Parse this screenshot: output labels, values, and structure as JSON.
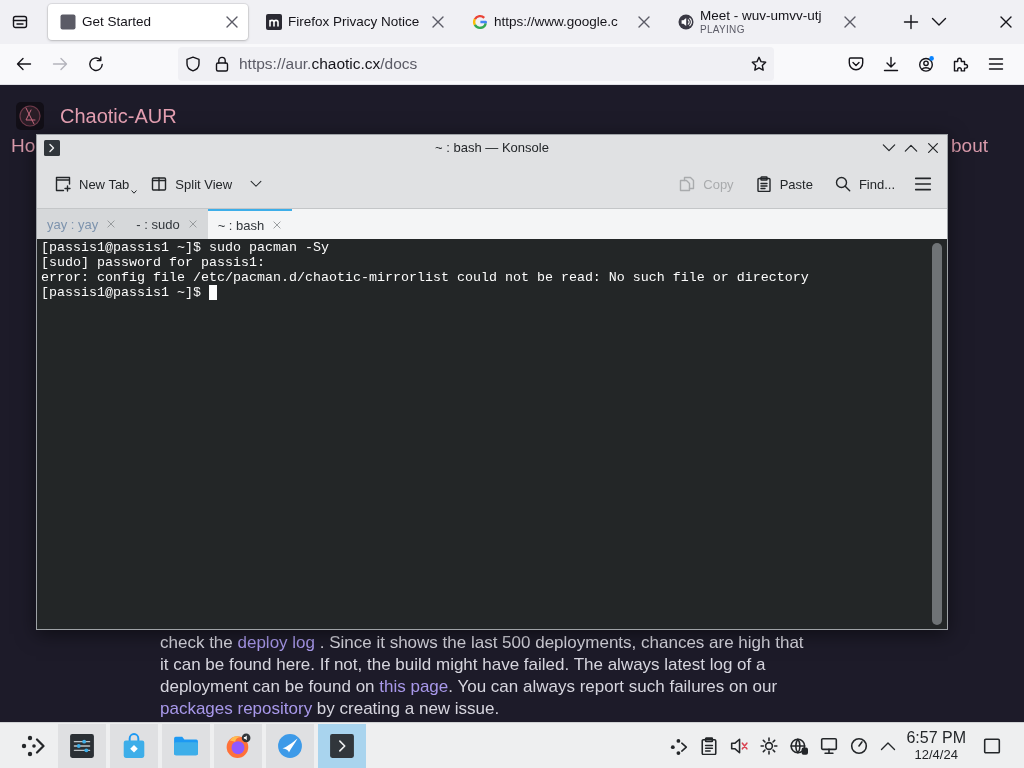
{
  "browser": {
    "tabs": [
      {
        "kind": "page",
        "title": "Get Started",
        "selected": true
      },
      {
        "kind": "mozilla",
        "title": "Firefox Privacy Notice",
        "selected": false
      },
      {
        "kind": "google",
        "title": "https://www.google.c",
        "selected": false
      },
      {
        "kind": "meet",
        "title": "Meet - wuv-umvv-utj",
        "subtitle": "PLAYING",
        "selected": false
      }
    ],
    "nav": [
      {
        "kind": "back",
        "disabled": false
      },
      {
        "kind": "forward",
        "disabled": true
      },
      {
        "kind": "reload",
        "disabled": false
      }
    ],
    "url": [
      {
        "text": "https://aur.",
        "emphasis": false
      },
      {
        "text": "chaotic.cx",
        "emphasis": true
      },
      {
        "text": "/docs",
        "emphasis": false
      }
    ]
  },
  "page": {
    "site_title": "Chaotic-AUR",
    "nav_left": "Ho",
    "nav_right": "bout",
    "paragraph": [
      [
        {
          "kind": "text",
          "text": "check the "
        },
        {
          "kind": "link",
          "text": "deploy log"
        },
        {
          "kind": "text",
          "text": " . Since it shows the last 500 deployments, chances are high that"
        }
      ],
      [
        {
          "kind": "text",
          "text": "it can be found here. If not, the build might have failed. The always latest log of a"
        }
      ],
      [
        {
          "kind": "text",
          "text": "deployment can be found on "
        },
        {
          "kind": "link",
          "text": "this page"
        },
        {
          "kind": "text",
          "text": ". You can always report such failures on our"
        }
      ],
      [
        {
          "kind": "link",
          "text": "packages repository"
        },
        {
          "kind": "text",
          "text": " by creating a new issue."
        }
      ]
    ]
  },
  "konsole": {
    "title": "~ : bash — Konsole",
    "toolbar": {
      "left": [
        {
          "kind": "new-tab",
          "label": "New Tab",
          "disabled": false
        },
        {
          "kind": "split-view",
          "label": "Split View",
          "disabled": false
        }
      ],
      "right": [
        {
          "kind": "copy",
          "label": "Copy",
          "disabled": true
        },
        {
          "kind": "paste",
          "label": "Paste",
          "disabled": false
        },
        {
          "kind": "find",
          "label": "Find...",
          "disabled": false
        }
      ]
    },
    "tabs": [
      {
        "label": "yay : yay",
        "selected": false,
        "activity": true
      },
      {
        "label": "- : sudo",
        "selected": false,
        "activity": false
      },
      {
        "label": "~ : bash",
        "selected": true,
        "activity": false
      }
    ],
    "terminal": {
      "lines": [
        "[passis1@passis1 ~]$ sudo pacman -Sy",
        "[sudo] password for passis1:",
        "error: config file /etc/pacman.d/chaotic-mirrorlist could not be read: No such file or directory",
        "[passis1@passis1 ~]$"
      ],
      "cursor": true
    }
  },
  "taskbar": {
    "apps": [
      {
        "kind": "settings",
        "selected": false
      },
      {
        "kind": "discover",
        "selected": false
      },
      {
        "kind": "files",
        "selected": false
      },
      {
        "kind": "firefox",
        "selected": false
      },
      {
        "kind": "swoosh",
        "selected": false
      },
      {
        "kind": "konsole",
        "selected": true
      }
    ],
    "time": "6:57 PM",
    "date": "12/4/24"
  }
}
